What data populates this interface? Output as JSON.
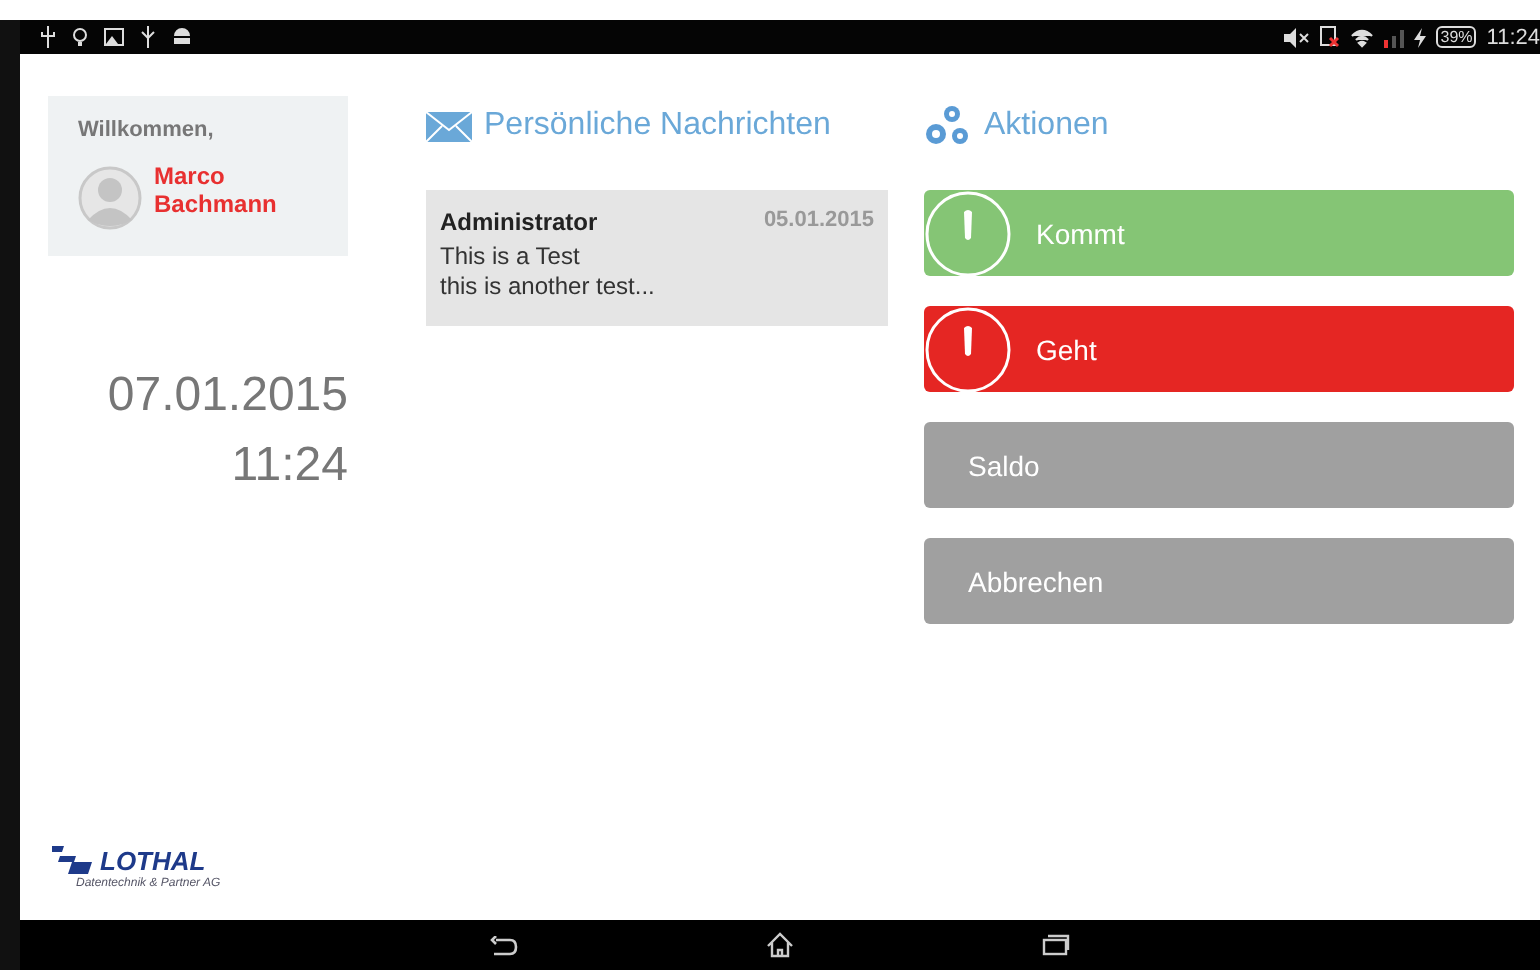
{
  "status_bar": {
    "battery": "39%",
    "time": "11:24"
  },
  "welcome": {
    "greeting": "Willkommen,",
    "first_name": "Marco",
    "last_name": "Bachmann"
  },
  "clock": {
    "date": "07.01.2015",
    "time": "11:24"
  },
  "messages": {
    "title": "Persönliche Nachrichten",
    "items": [
      {
        "sender": "Administrator",
        "date": "05.01.2015",
        "lines": [
          "This is a Test",
          "this is another test..."
        ]
      }
    ]
  },
  "actions": {
    "title": "Aktionen",
    "buttons": [
      {
        "label": "Kommt",
        "kind": "timer",
        "color": "#85c575"
      },
      {
        "label": "Geht",
        "kind": "timer",
        "color": "#e52623"
      },
      {
        "label": "Saldo",
        "kind": "plain",
        "color": "#a0a0a0"
      },
      {
        "label": "Abbrechen",
        "kind": "plain",
        "color": "#a0a0a0"
      }
    ]
  },
  "logo": {
    "name": "LOTHAL",
    "tagline": "Datentechnik & Partner AG"
  }
}
